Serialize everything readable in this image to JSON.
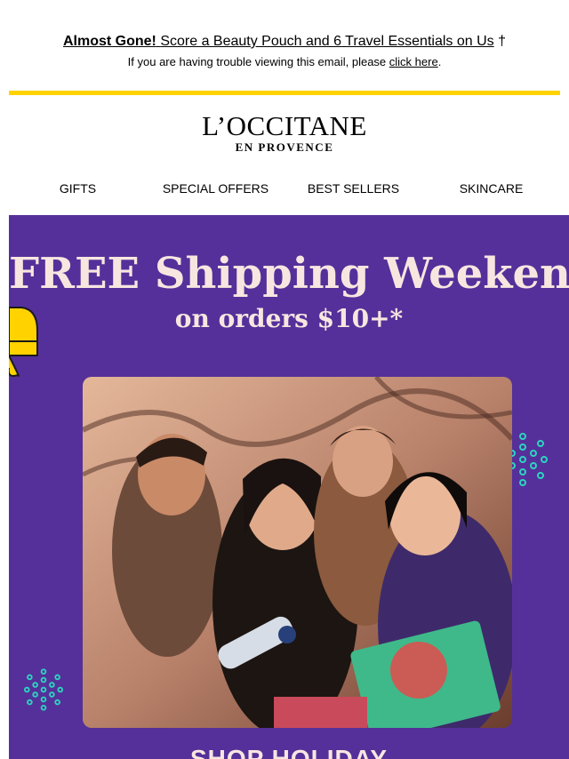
{
  "preheader": {
    "promo_strong": "Almost Gone!",
    "promo_text": "Score a Beauty Pouch and 6 Travel Essentials on Us",
    "dagger": "†",
    "trouble_text": "If you are having trouble viewing this email, please",
    "trouble_link": "click here",
    "trouble_end": "."
  },
  "brand": {
    "name": "L’OCCITANE",
    "sub": "EN PROVENCE",
    "accent_yellow": "#FFD200",
    "hero_purple": "#55309A"
  },
  "nav": {
    "items": [
      "GIFTS",
      "SPECIAL OFFERS",
      "BEST SELLERS",
      "SKINCARE"
    ]
  },
  "hero": {
    "title": "FREE Shipping Weekend",
    "subtitle": "on orders $10+*",
    "cta": "SHOP HOLIDAY",
    "photo_alt": "Four friends smiling holding L'Occitane gift products"
  }
}
